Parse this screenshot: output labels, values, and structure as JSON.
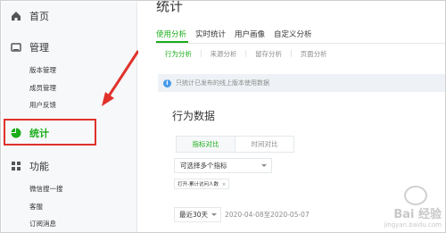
{
  "sidebar": {
    "home": "首页",
    "manage": {
      "label": "管理",
      "items": [
        "版本管理",
        "成员管理",
        "用户反馈"
      ]
    },
    "stats": "统计",
    "features": {
      "label": "功能",
      "items": [
        "微信搜一搜",
        "客服",
        "订阅消息"
      ]
    }
  },
  "main": {
    "title": "统计",
    "tabs": [
      "使用分析",
      "实时统计",
      "用户画像",
      "自定义分析"
    ],
    "subtabs": [
      "行为分析",
      "来源分析",
      "留存分析",
      "页面分析"
    ],
    "notice": "只统计已发布的线上版本使用数据",
    "panel_title": "行为数据",
    "segment": [
      "指标对比",
      "时间对比"
    ],
    "select_placeholder": "可选择多个指标",
    "chip_label": "打开-累计访问人数",
    "chip_close": "×",
    "date_select": "最近30天",
    "date_range": "2020-04-08至2020-05-07"
  },
  "watermark": {
    "logo": "Bai 经验",
    "url": "jingyan.baidu.com"
  },
  "colors": {
    "accent": "#1aad19",
    "highlight": "#e0322b",
    "arrow": "#e0322b"
  }
}
